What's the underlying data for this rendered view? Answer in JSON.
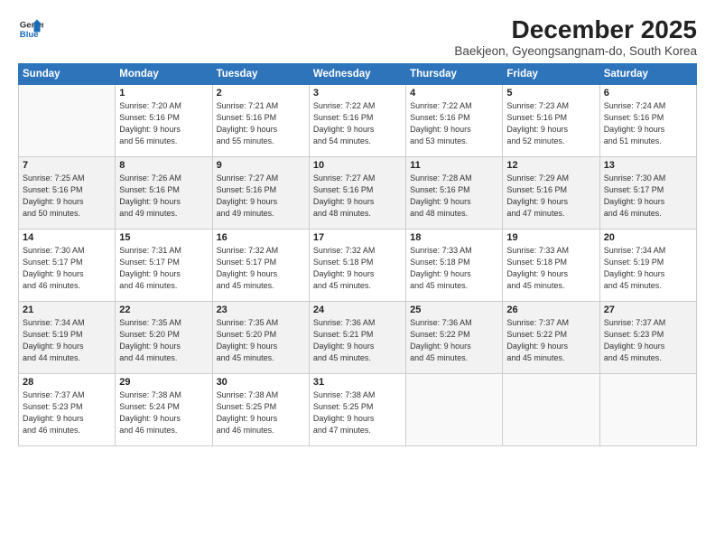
{
  "logo": {
    "line1": "General",
    "line2": "Blue"
  },
  "title": "December 2025",
  "subtitle": "Baekjeon, Gyeongsangnam-do, South Korea",
  "days_header": [
    "Sunday",
    "Monday",
    "Tuesday",
    "Wednesday",
    "Thursday",
    "Friday",
    "Saturday"
  ],
  "weeks": [
    [
      {
        "day": "",
        "text": ""
      },
      {
        "day": "1",
        "text": "Sunrise: 7:20 AM\nSunset: 5:16 PM\nDaylight: 9 hours\nand 56 minutes."
      },
      {
        "day": "2",
        "text": "Sunrise: 7:21 AM\nSunset: 5:16 PM\nDaylight: 9 hours\nand 55 minutes."
      },
      {
        "day": "3",
        "text": "Sunrise: 7:22 AM\nSunset: 5:16 PM\nDaylight: 9 hours\nand 54 minutes."
      },
      {
        "day": "4",
        "text": "Sunrise: 7:22 AM\nSunset: 5:16 PM\nDaylight: 9 hours\nand 53 minutes."
      },
      {
        "day": "5",
        "text": "Sunrise: 7:23 AM\nSunset: 5:16 PM\nDaylight: 9 hours\nand 52 minutes."
      },
      {
        "day": "6",
        "text": "Sunrise: 7:24 AM\nSunset: 5:16 PM\nDaylight: 9 hours\nand 51 minutes."
      }
    ],
    [
      {
        "day": "7",
        "text": "Sunrise: 7:25 AM\nSunset: 5:16 PM\nDaylight: 9 hours\nand 50 minutes."
      },
      {
        "day": "8",
        "text": "Sunrise: 7:26 AM\nSunset: 5:16 PM\nDaylight: 9 hours\nand 49 minutes."
      },
      {
        "day": "9",
        "text": "Sunrise: 7:27 AM\nSunset: 5:16 PM\nDaylight: 9 hours\nand 49 minutes."
      },
      {
        "day": "10",
        "text": "Sunrise: 7:27 AM\nSunset: 5:16 PM\nDaylight: 9 hours\nand 48 minutes."
      },
      {
        "day": "11",
        "text": "Sunrise: 7:28 AM\nSunset: 5:16 PM\nDaylight: 9 hours\nand 48 minutes."
      },
      {
        "day": "12",
        "text": "Sunrise: 7:29 AM\nSunset: 5:16 PM\nDaylight: 9 hours\nand 47 minutes."
      },
      {
        "day": "13",
        "text": "Sunrise: 7:30 AM\nSunset: 5:17 PM\nDaylight: 9 hours\nand 46 minutes."
      }
    ],
    [
      {
        "day": "14",
        "text": "Sunrise: 7:30 AM\nSunset: 5:17 PM\nDaylight: 9 hours\nand 46 minutes."
      },
      {
        "day": "15",
        "text": "Sunrise: 7:31 AM\nSunset: 5:17 PM\nDaylight: 9 hours\nand 46 minutes."
      },
      {
        "day": "16",
        "text": "Sunrise: 7:32 AM\nSunset: 5:17 PM\nDaylight: 9 hours\nand 45 minutes."
      },
      {
        "day": "17",
        "text": "Sunrise: 7:32 AM\nSunset: 5:18 PM\nDaylight: 9 hours\nand 45 minutes."
      },
      {
        "day": "18",
        "text": "Sunrise: 7:33 AM\nSunset: 5:18 PM\nDaylight: 9 hours\nand 45 minutes."
      },
      {
        "day": "19",
        "text": "Sunrise: 7:33 AM\nSunset: 5:18 PM\nDaylight: 9 hours\nand 45 minutes."
      },
      {
        "day": "20",
        "text": "Sunrise: 7:34 AM\nSunset: 5:19 PM\nDaylight: 9 hours\nand 45 minutes."
      }
    ],
    [
      {
        "day": "21",
        "text": "Sunrise: 7:34 AM\nSunset: 5:19 PM\nDaylight: 9 hours\nand 44 minutes."
      },
      {
        "day": "22",
        "text": "Sunrise: 7:35 AM\nSunset: 5:20 PM\nDaylight: 9 hours\nand 44 minutes."
      },
      {
        "day": "23",
        "text": "Sunrise: 7:35 AM\nSunset: 5:20 PM\nDaylight: 9 hours\nand 45 minutes."
      },
      {
        "day": "24",
        "text": "Sunrise: 7:36 AM\nSunset: 5:21 PM\nDaylight: 9 hours\nand 45 minutes."
      },
      {
        "day": "25",
        "text": "Sunrise: 7:36 AM\nSunset: 5:22 PM\nDaylight: 9 hours\nand 45 minutes."
      },
      {
        "day": "26",
        "text": "Sunrise: 7:37 AM\nSunset: 5:22 PM\nDaylight: 9 hours\nand 45 minutes."
      },
      {
        "day": "27",
        "text": "Sunrise: 7:37 AM\nSunset: 5:23 PM\nDaylight: 9 hours\nand 45 minutes."
      }
    ],
    [
      {
        "day": "28",
        "text": "Sunrise: 7:37 AM\nSunset: 5:23 PM\nDaylight: 9 hours\nand 46 minutes."
      },
      {
        "day": "29",
        "text": "Sunrise: 7:38 AM\nSunset: 5:24 PM\nDaylight: 9 hours\nand 46 minutes."
      },
      {
        "day": "30",
        "text": "Sunrise: 7:38 AM\nSunset: 5:25 PM\nDaylight: 9 hours\nand 46 minutes."
      },
      {
        "day": "31",
        "text": "Sunrise: 7:38 AM\nSunset: 5:25 PM\nDaylight: 9 hours\nand 47 minutes."
      },
      {
        "day": "",
        "text": ""
      },
      {
        "day": "",
        "text": ""
      },
      {
        "day": "",
        "text": ""
      }
    ]
  ]
}
